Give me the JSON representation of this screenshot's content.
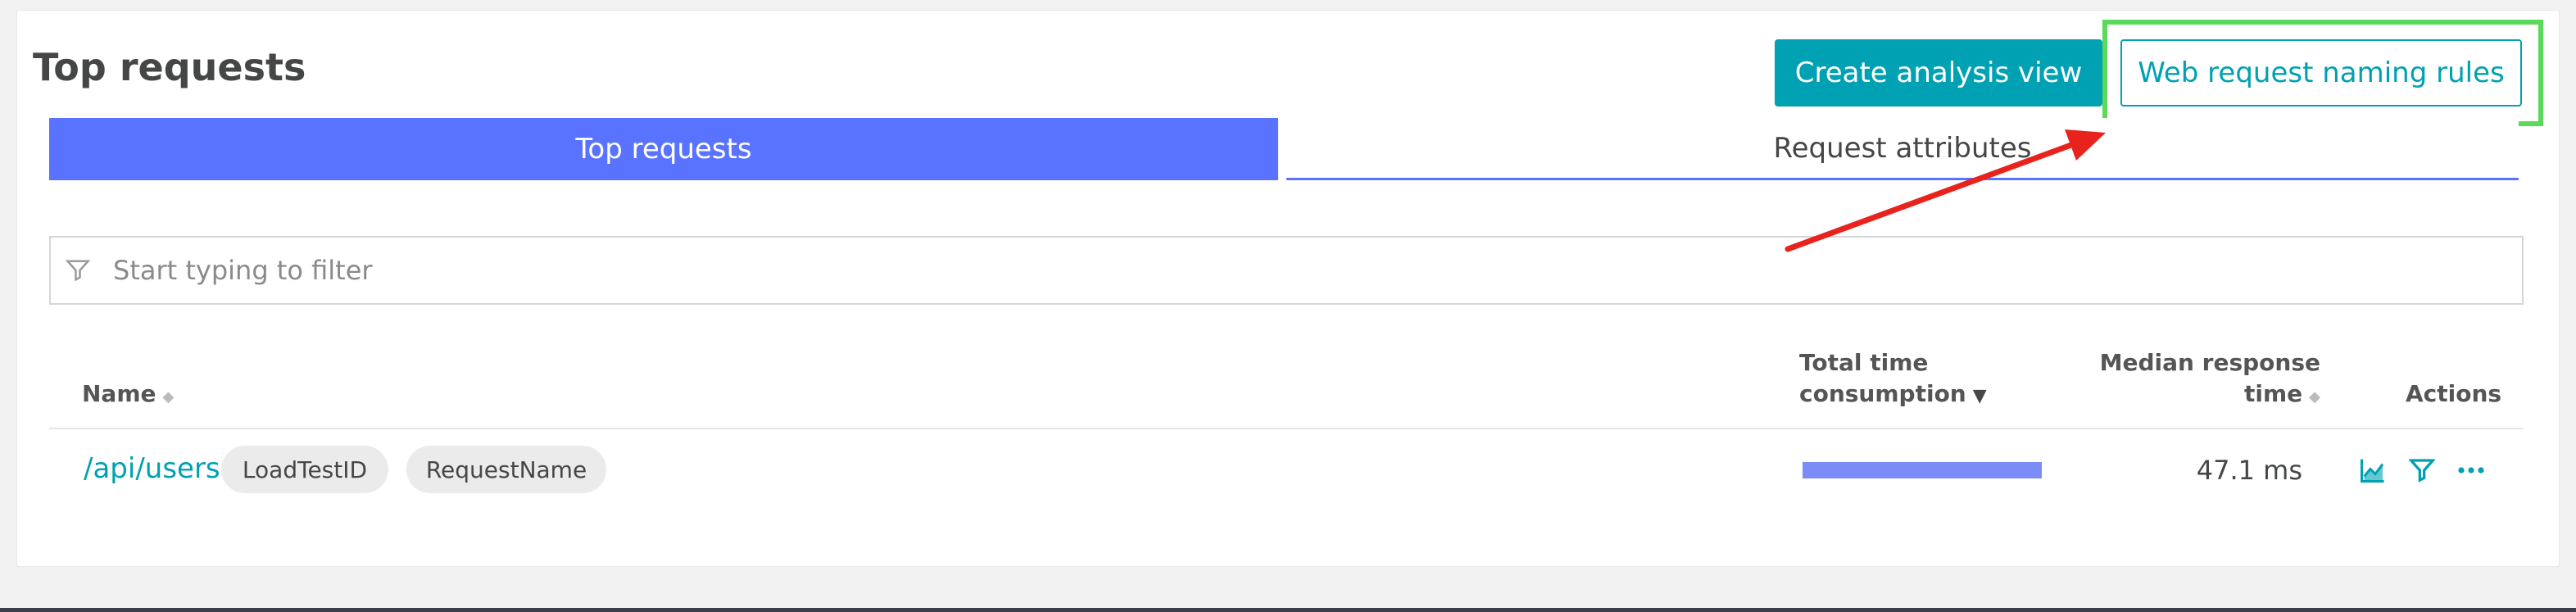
{
  "page": {
    "title": "Top requests"
  },
  "buttons": {
    "create_analysis_view": "Create analysis view",
    "web_request_naming_rules": "Web request naming rules"
  },
  "tabs": [
    {
      "label": "Top requests",
      "active": true
    },
    {
      "label": "Request attributes",
      "active": false
    }
  ],
  "filter": {
    "placeholder": "Start typing to filter"
  },
  "table": {
    "columns": {
      "name": "Name",
      "total_time_line1": "Total time",
      "total_time_line2": "consumption",
      "median_line1": "Median response",
      "median_line2": "time",
      "actions": "Actions"
    },
    "rows": [
      {
        "name": "/api/users",
        "chips": [
          "LoadTestID",
          "RequestName"
        ],
        "total_time_share": 1.0,
        "median_response_time": "47.1 ms"
      }
    ]
  },
  "icons": {
    "filter": "filter-icon",
    "chart": "chart-icon",
    "row_filter": "filter-icon",
    "more": "more-icon"
  },
  "colors": {
    "accent_teal": "#00a1b2",
    "tab_active": "#5a73ff",
    "bar": "#7b8cf6",
    "highlight": "#5ad95a",
    "arrow": "#e8231d"
  }
}
